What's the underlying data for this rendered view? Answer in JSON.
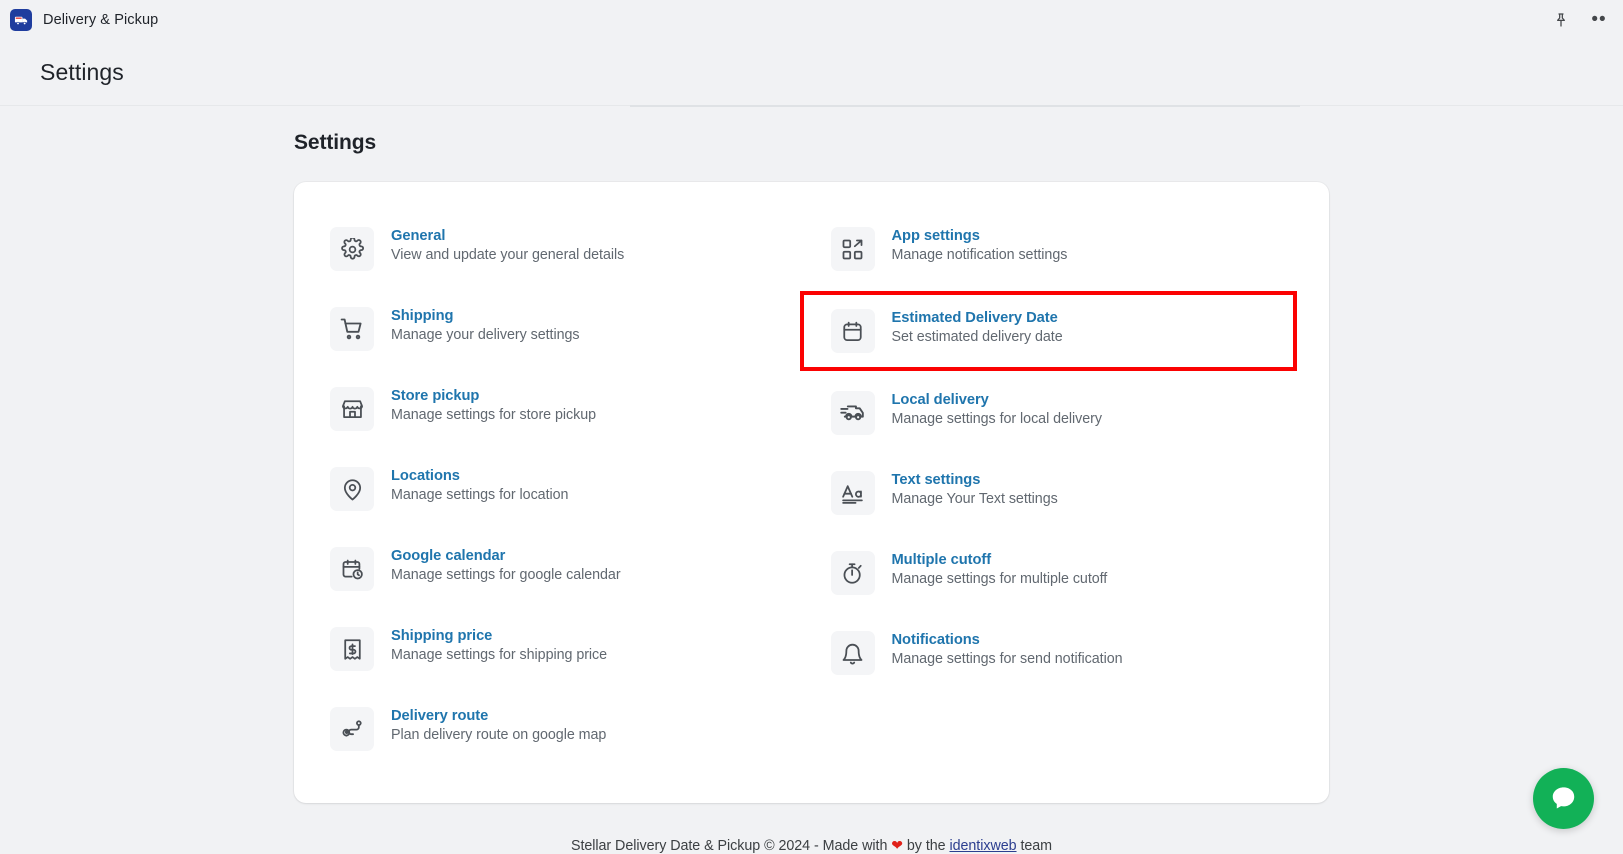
{
  "appbar": {
    "app_name": "Delivery & Pickup",
    "app_icon": "delivery-truck-icon",
    "pin_icon": "pin-icon",
    "more_icon": "more-horizontal-icon",
    "more_label": "••"
  },
  "header": {
    "title": "Settings"
  },
  "main": {
    "section_title": "Settings",
    "left_items": [
      {
        "icon": "gear-icon",
        "title": "General",
        "desc": "View and update your general details"
      },
      {
        "icon": "shopping-cart-icon",
        "title": "Shipping",
        "desc": "Manage your delivery settings"
      },
      {
        "icon": "store-icon",
        "title": "Store pickup",
        "desc": "Manage settings for store pickup"
      },
      {
        "icon": "location-pin-icon",
        "title": "Locations",
        "desc": "Manage settings for location"
      },
      {
        "icon": "calendar-clock-icon",
        "title": "Google calendar",
        "desc": "Manage settings for google calendar"
      },
      {
        "icon": "receipt-dollar-icon",
        "title": "Shipping price",
        "desc": "Manage settings for shipping price"
      },
      {
        "icon": "route-icon",
        "title": "Delivery route",
        "desc": "Plan delivery route on google map"
      }
    ],
    "right_items": [
      {
        "icon": "app-grid-icon",
        "title": "App settings",
        "desc": "Manage notification settings",
        "highlighted": false
      },
      {
        "icon": "calendar-box-icon",
        "title": "Estimated Delivery Date",
        "desc": "Set estimated delivery date",
        "highlighted": true
      },
      {
        "icon": "local-delivery-van-icon",
        "title": "Local delivery",
        "desc": "Manage settings for local delivery",
        "highlighted": false
      },
      {
        "icon": "text-format-icon",
        "title": "Text settings",
        "desc": "Manage Your Text settings",
        "highlighted": false
      },
      {
        "icon": "stopwatch-icon",
        "title": "Multiple cutoff",
        "desc": "Manage settings for multiple cutoff",
        "highlighted": false
      },
      {
        "icon": "bell-icon",
        "title": "Notifications",
        "desc": "Manage settings for send notification",
        "highlighted": false
      }
    ]
  },
  "footer": {
    "prefix": "Stellar Delivery Date & Pickup © 2024 - Made with ",
    "heart": "❤",
    "middle": " by the ",
    "link": "identixweb",
    "suffix": " team"
  },
  "chat": {
    "icon": "chat-bubble-icon",
    "color": "#12b157"
  },
  "colors": {
    "link": "#1f75ad",
    "highlight": "#fb0202",
    "page_bg": "#f1f2f4",
    "card_bg": "#ffffff"
  }
}
